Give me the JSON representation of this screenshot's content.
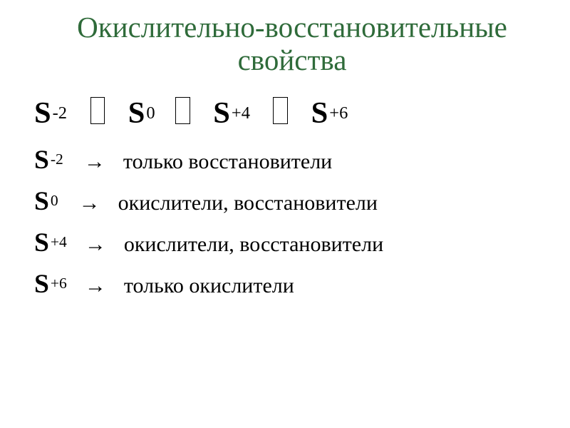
{
  "title": "Окислительно-восстановительные свойства",
  "element": "S",
  "oxidation_states": [
    "-2",
    "0",
    "+4",
    "+6"
  ],
  "arrow": "→",
  "rules": [
    {
      "state": "-2",
      "text": "только восстановители"
    },
    {
      "state": "0",
      "text": "окислители, восстановители"
    },
    {
      "state": "+4",
      "text": "окислители, восстановители"
    },
    {
      "state": "+6",
      "text": "только окислители"
    }
  ]
}
